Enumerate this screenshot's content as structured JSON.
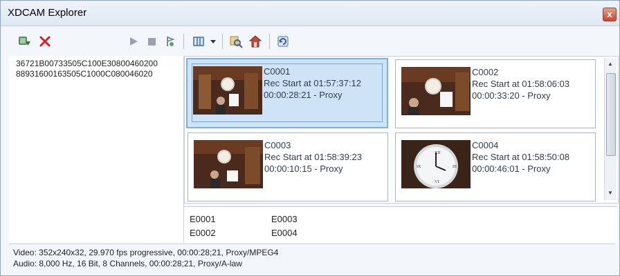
{
  "window": {
    "title": "XDCAM Explorer",
    "close_symbol": "x"
  },
  "toolbar": {
    "items": [
      {
        "icon": "import-disc-icon"
      },
      {
        "icon": "delete-icon"
      },
      {
        "icon": "play-icon"
      },
      {
        "icon": "stop-icon"
      },
      {
        "icon": "mark-icon"
      },
      {
        "icon": "view-mode-icon"
      },
      {
        "icon": "dropdown-arrow-icon"
      },
      {
        "icon": "browse-icon"
      },
      {
        "icon": "export-icon"
      },
      {
        "icon": "refresh-icon"
      }
    ]
  },
  "discs": [
    {
      "id": "36721B00733505C100E30800460200"
    },
    {
      "id": "88931600163505C1000C080046020"
    }
  ],
  "clips": [
    {
      "name": "C0001",
      "rec_start": "Rec Start at 01:57:37:12",
      "duration": "00:00:28:21 - Proxy",
      "selected": true
    },
    {
      "name": "C0002",
      "rec_start": "Rec Start at 01:58:06:03",
      "duration": "00:00:33:20 - Proxy",
      "selected": false
    },
    {
      "name": "C0003",
      "rec_start": "Rec Start at 01:58:39:23",
      "duration": "00:00:10:15 - Proxy",
      "selected": false
    },
    {
      "name": "C0004",
      "rec_start": "Rec Start at 01:58:50:08",
      "duration": "00:00:46:01 - Proxy",
      "selected": false
    }
  ],
  "essence_marks": [
    "E0001",
    "E0002",
    "E0003",
    "E0004"
  ],
  "status": {
    "video": "Video: 352x240x32, 29.970 fps progressive, 00:00:28;21, Proxy/MPEG4",
    "audio": "Audio: 8,000 Hz, 16 Bit, 8 Channels, 00:00:28;21, Proxy/A-law"
  },
  "colors": {
    "selection": "#cfe3f7",
    "selection_border": "#79b1e6",
    "delete_red": "#d42020"
  }
}
